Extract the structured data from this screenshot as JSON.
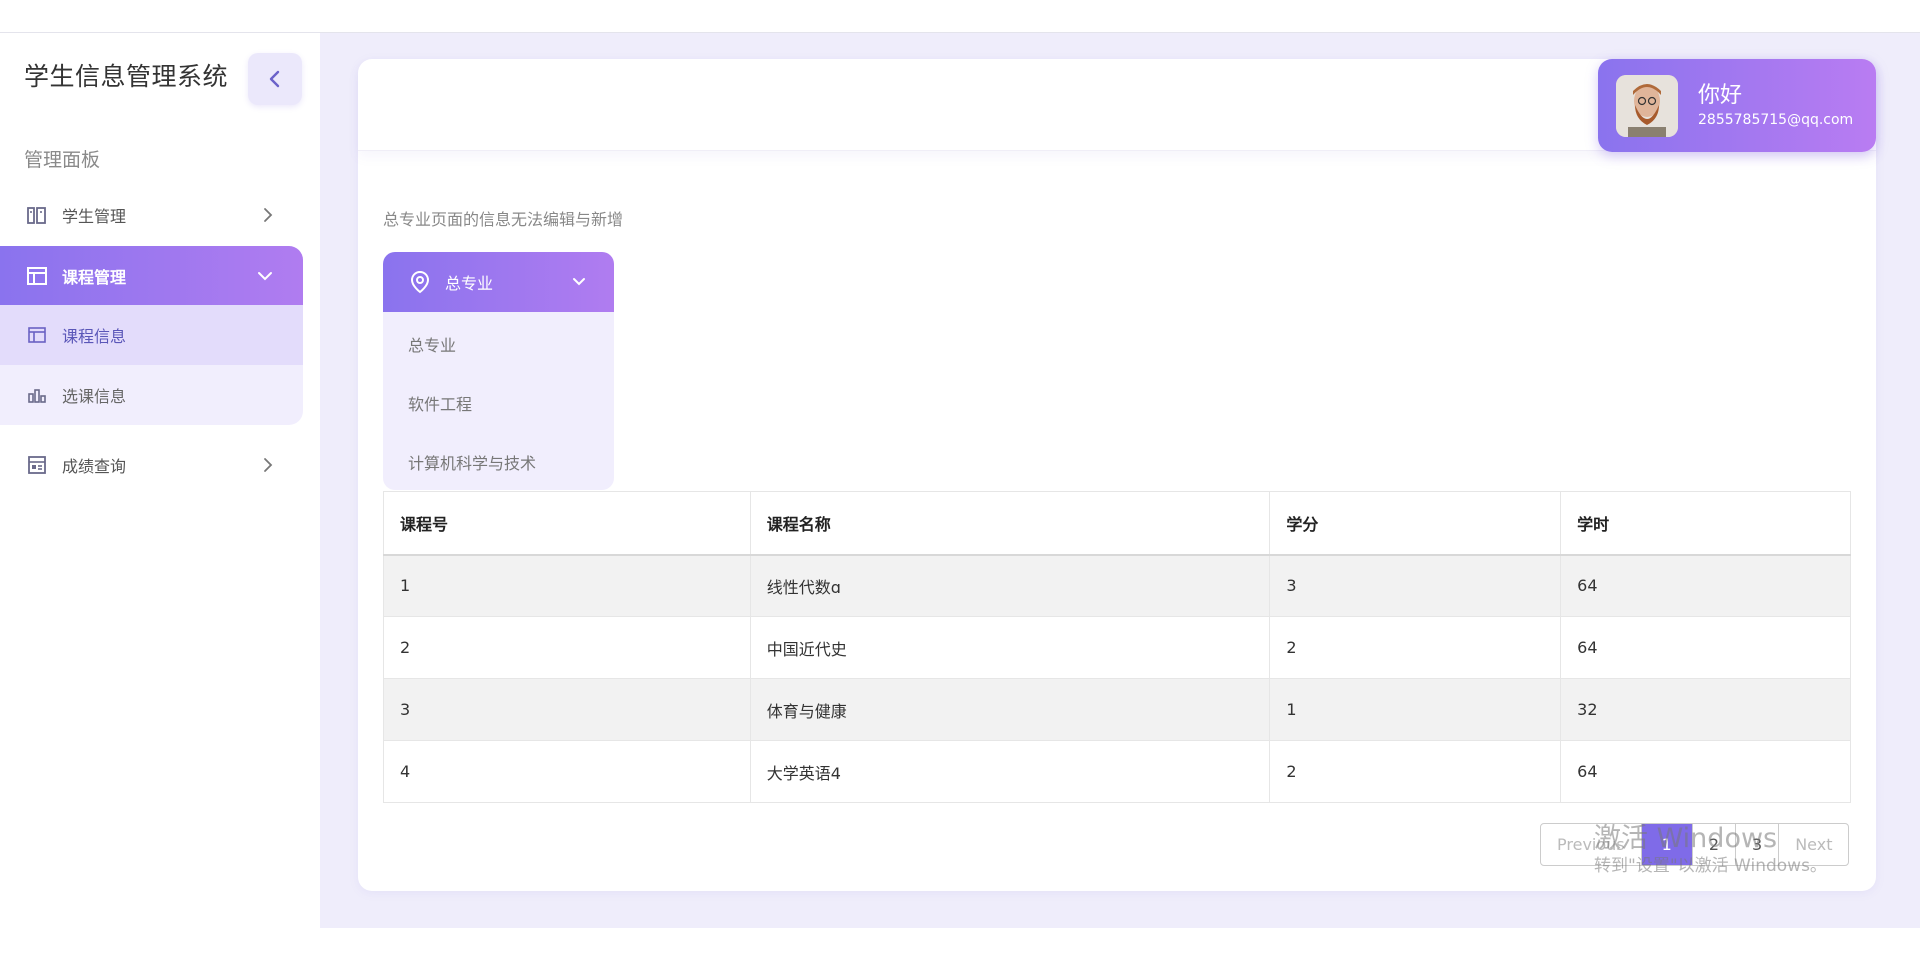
{
  "sidebar": {
    "brand": "学生信息管理系统",
    "section_title": "管理面板",
    "items": [
      {
        "label": "学生管理",
        "icon": "student-icon"
      },
      {
        "label": "课程管理",
        "icon": "table-icon"
      },
      {
        "label": "成绩查询",
        "icon": "report-icon"
      }
    ],
    "submenu": [
      {
        "label": "课程信息",
        "icon": "table-icon"
      },
      {
        "label": "选课信息",
        "icon": "bar-chart-icon"
      }
    ]
  },
  "user": {
    "greeting": "你好",
    "email": "2855785715@qq.com"
  },
  "main": {
    "notice": "总专业页面的信息无法编辑与新增",
    "dropdown": {
      "selected": "总专业",
      "options": [
        "总专业",
        "软件工程",
        "计算机科学与技术"
      ]
    },
    "table": {
      "headers": [
        "课程号",
        "课程名称",
        "学分",
        "学时"
      ],
      "rows": [
        [
          "1",
          "线性代数ɑ",
          "3",
          "64"
        ],
        [
          "2",
          "中国近代史",
          "2",
          "64"
        ],
        [
          "3",
          "体育与健康",
          "1",
          "32"
        ],
        [
          "4",
          "大学英语4",
          "2",
          "64"
        ]
      ]
    },
    "pagination": {
      "previous": "Previous",
      "pages": [
        "1",
        "2",
        "3"
      ],
      "current": "1",
      "next": "Next"
    }
  },
  "watermark": {
    "line1": "激活 Windows",
    "line2": "转到\"设置\"以激活 Windows。"
  },
  "colors": {
    "accent_start": "#8a73ee",
    "accent_end": "#b07cf0",
    "page_bg": "#efedfb"
  }
}
